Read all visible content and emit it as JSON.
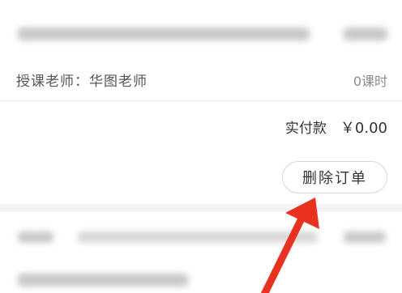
{
  "order": {
    "teacher_label": "授课老师：华图老师",
    "lesson_count": "0课时",
    "paid_label": "实付款",
    "paid_amount": "￥0.00",
    "delete_button_label": "删除订单"
  },
  "colors": {
    "annotation_arrow": "#e8321f",
    "card_background": "#ffffff",
    "page_background": "#f4f4f4"
  },
  "icons": {
    "annotation": "red-arrow-icon"
  }
}
